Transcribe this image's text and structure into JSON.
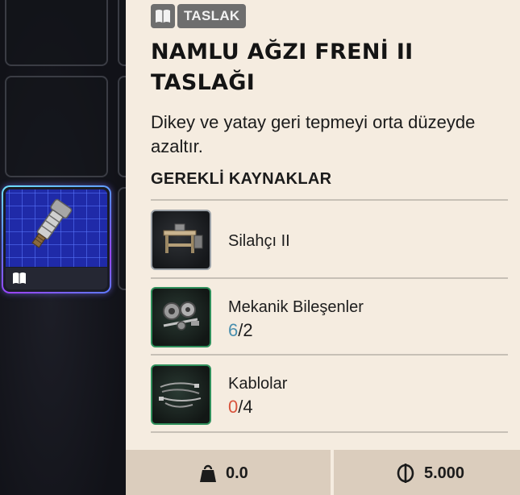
{
  "badge": {
    "label": "TASLAK",
    "icon": "book-icon"
  },
  "item": {
    "title": "NAMLU AĞZI FRENİ II TASLAĞI",
    "description": "Dikey ve yatay geri tepmeyi orta düzeyde azaltır."
  },
  "requirements": {
    "heading": "GEREKLİ KAYNAKLAR",
    "items": [
      {
        "name": "Silahçı II",
        "icon": "workbench-icon"
      },
      {
        "name": "Mekanik Bileşenler",
        "have": "6",
        "need": "/2",
        "have_color": "#4a8fae",
        "icon": "mechanical-parts-icon"
      },
      {
        "name": "Kablolar",
        "have": "0",
        "need": "/4",
        "have_color": "#d8533c",
        "icon": "cables-icon"
      }
    ]
  },
  "footer": {
    "weight": "0.0",
    "price": "5.000",
    "weight_icon": "weight-icon",
    "price_icon": "coin-icon"
  },
  "colors": {
    "panel_bg": "#f5ece0",
    "footer_bg": "#dbcdbd",
    "badge_bg": "#6e6e6e",
    "selected_border": "#7a5cff"
  }
}
